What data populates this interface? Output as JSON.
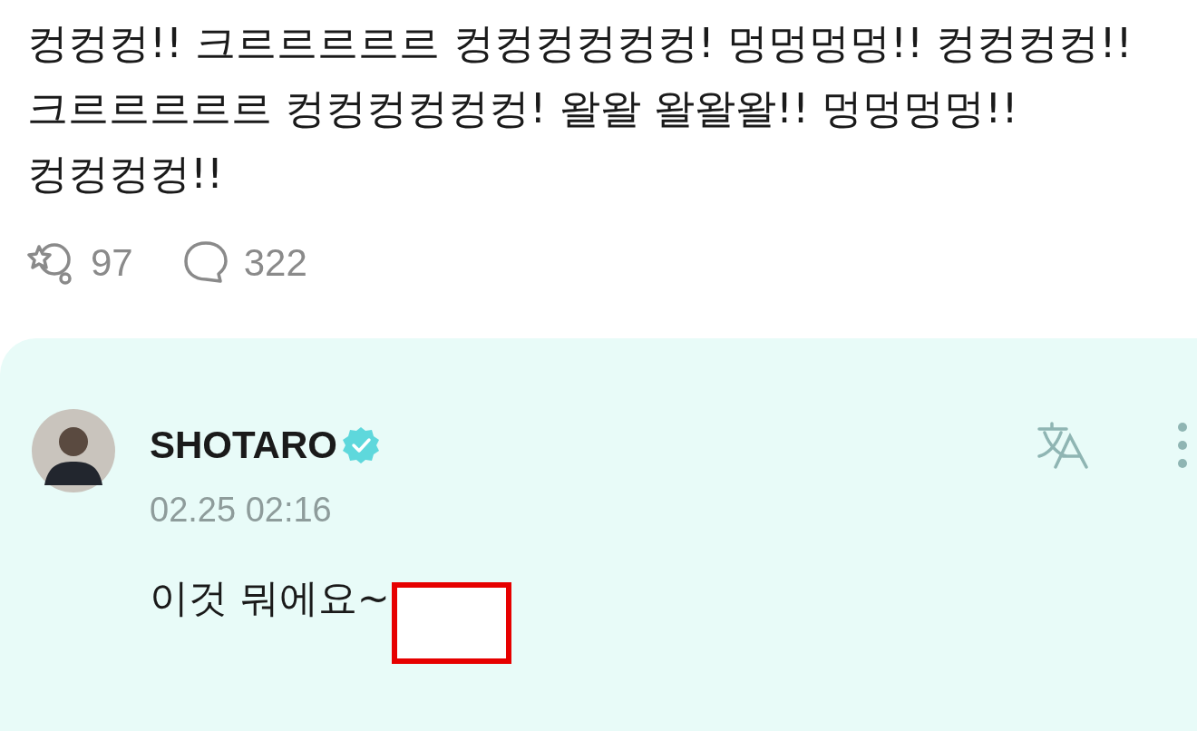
{
  "post": {
    "text": "컹컹컹!! 크르르르르르 컹컹컹컹컹컹! 멍멍멍멍!! 컹컹컹컹!! 크르르르르르 컹컹컹컹컹컹! 왈왈 왈왈왈!! 멍멍멍멍!! 컹컹컹컹!!"
  },
  "stats": [
    {
      "kind": "reactions",
      "count": "97"
    },
    {
      "kind": "comments",
      "count": "322"
    }
  ],
  "comment": {
    "author": "SHOTARO",
    "verified": true,
    "time": "02.25 02:16",
    "text": "이것 뭐에요~",
    "redacted": true
  }
}
